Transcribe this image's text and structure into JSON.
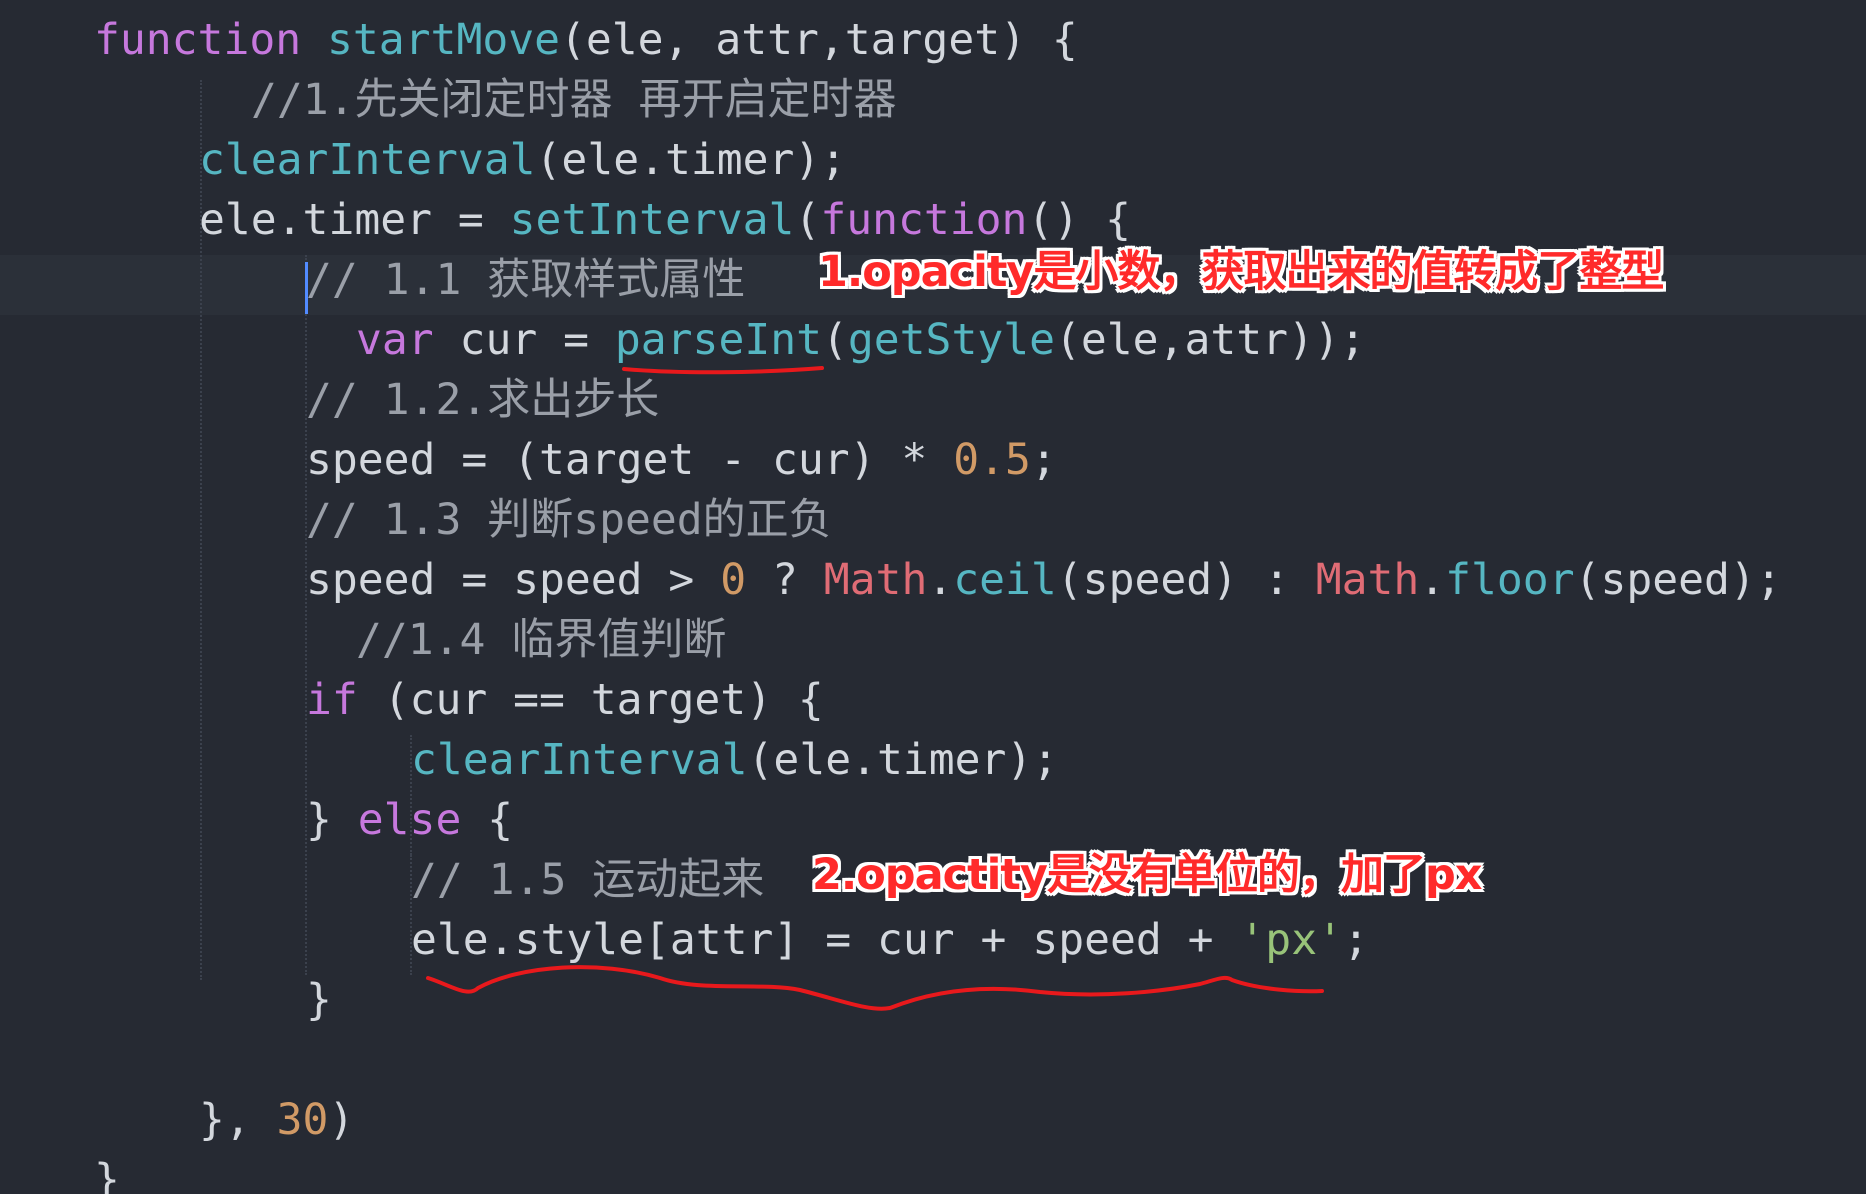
{
  "code": {
    "line1": {
      "kw_function": "function",
      "fn_name": "startMove",
      "params": "(ele, attr,target) {"
    },
    "line2": {
      "comment": "//1.先关闭定时器 再开启定时器"
    },
    "line3": {
      "fn": "clearInterval",
      "rest": "(ele.timer);"
    },
    "line4": {
      "lhs": "ele.timer = ",
      "fn": "setInterval",
      "open": "(",
      "kw": "function",
      "rest": "() {"
    },
    "line5": {
      "comment": "// 1.1 获取样式属性"
    },
    "line6": {
      "kw": "var",
      "mid": " cur = ",
      "fn1": "parseInt",
      "open": "(",
      "fn2": "getStyle",
      "rest": "(ele,attr));"
    },
    "line7": {
      "comment": "// 1.2.求出步长"
    },
    "line8": {
      "pre": "speed = (target - cur) * ",
      "num": "0.5",
      "post": ";"
    },
    "line9": {
      "comment": "// 1.3 判断speed的正负"
    },
    "line10": {
      "pre": "speed = speed > ",
      "num": "0",
      "q": " ? ",
      "math1": "Math",
      "dot1": ".",
      "ceil": "ceil",
      "mid": "(speed) : ",
      "math2": "Math",
      "dot2": ".",
      "floor": "floor",
      "post": "(speed);"
    },
    "line11": {
      "comment": "//1.4 临界值判断"
    },
    "line12": {
      "kw": "if",
      "rest": " (cur == target) {"
    },
    "line13": {
      "fn": "clearInterval",
      "rest": "(ele.timer);"
    },
    "line14": {
      "brace": "} ",
      "kw": "else",
      "rest": " {"
    },
    "line15": {
      "comment": "// 1.5 运动起来"
    },
    "line16": {
      "pre": "ele.style[attr] = cur + speed + ",
      "str": "'px'",
      "post": ";"
    },
    "line17": {
      "brace": "}"
    },
    "line19": {
      "pre": "}, ",
      "num": "30",
      "post": ")"
    },
    "line20": {
      "brace": "}"
    }
  },
  "annotations": {
    "note1": "1.opacity是小数，获取出来的值转成了整型",
    "note2": "2.opactity是没有单位的，加了px",
    "mark_color": "#e8191c"
  },
  "theme": {
    "background": "#262a33",
    "keyword": "#c678dd",
    "function": "#56b6c2",
    "comment": "#9a9fa8",
    "number": "#d19a66",
    "class": "#e06c75",
    "string": "#98c379",
    "plain": "#d3d7dd"
  }
}
